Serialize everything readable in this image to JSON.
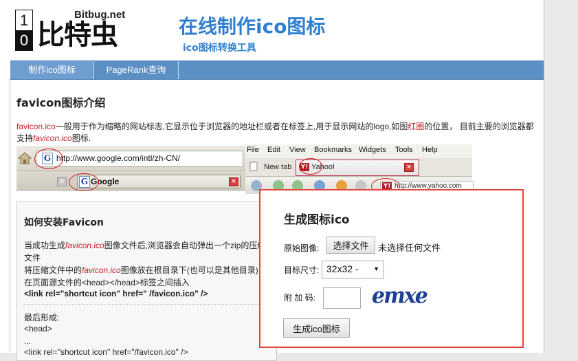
{
  "header": {
    "logo_digit_top": "1",
    "logo_digit_bottom": "0",
    "logo_domain": "Bitbug.net",
    "logo_name": "比特虫",
    "title": "在线制作ico图标",
    "subtitle": "ico图标转换工具"
  },
  "nav": {
    "items": [
      {
        "label": "制作ico图标",
        "active": true
      },
      {
        "label": "PageRank查询",
        "active": false
      }
    ]
  },
  "intro": {
    "heading": "favicon图标介绍",
    "term": "favicon.ico",
    "text_1": "一般用于作为缩略的网站标志,它显示位于浏览器的地址栏或者在标签上,用于显示网站的logo,如图",
    "highlight": "红圈",
    "text_2": "的位置， 目前主要的浏览器都支持",
    "term_italic": "favicon.ico",
    "text_3": "图标."
  },
  "demo": {
    "left_address": "http://www.google.com/intl/zh-CN/",
    "left_tab_title": "Google",
    "right_menu": [
      "File",
      "Edit",
      "View",
      "Bookmarks",
      "Widgets",
      "Tools",
      "Help"
    ],
    "right_new_tab": "New tab",
    "right_yahoo_tab": "Yahoo!",
    "right_url": "http://www.yahoo.com"
  },
  "howto": {
    "title": "如何安装Favicon",
    "line1_a": "当成功生成",
    "line1_term": "favicon.ico",
    "line1_b": "图像文件后,浏览器会自动弹出一个zip的压缩",
    "line2": "文件",
    "line3_a": "将压缩文件中的",
    "line3_term": "favicon.ico",
    "line3_b": "图像放在根目录下(也可以是其他目录)",
    "line4": "在页面源文件的<head></head>标签之间插入",
    "code": "<link rel=\"shortcut icon\" href=\" /favicon.ico\" />",
    "final_label": "最后形成:",
    "final_head": "<head>",
    "final_dots": "...",
    "final_link": "<link rel=\"shortcut icon\" href=\"/favicon.ico\" />"
  },
  "generator": {
    "title": "生成图标ico",
    "source_label": "原始图像:",
    "file_button": "选择文件",
    "file_status": "未选择任何文件",
    "size_label": "目标尺寸:",
    "size_value": "32x32 -",
    "code_label": "附 加 码:",
    "code_value": "",
    "captcha": "emxe",
    "submit": "生成ico图标"
  },
  "colors": {
    "brand_blue": "#2f7fd0",
    "nav_blue": "#5c8fc4",
    "highlight_red": "#c0212a",
    "overlay_red": "#e0443c"
  }
}
